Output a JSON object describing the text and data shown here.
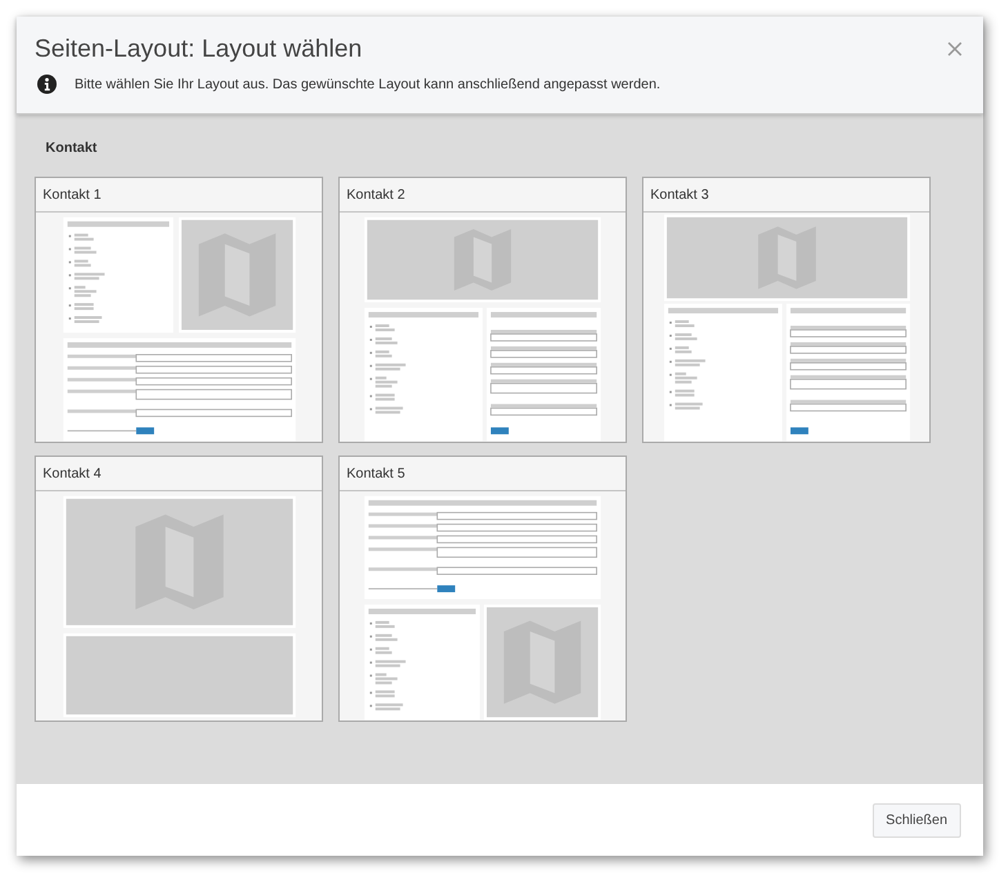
{
  "dialog": {
    "title": "Seiten-Layout: Layout wählen",
    "info": "Bitte wählen Sie Ihr Layout aus. Das gewünschte Layout kann anschließend angepasst werden.",
    "section": "Kontakt",
    "layouts": [
      {
        "title": "Kontakt 1",
        "kind": "split"
      },
      {
        "title": "Kontakt 2",
        "kind": "banner"
      },
      {
        "title": "Kontakt 3",
        "kind": "wide"
      },
      {
        "title": "Kontakt 4",
        "kind": "stacked"
      },
      {
        "title": "Kontakt 5",
        "kind": "formfirst"
      }
    ],
    "close_button": "Schließen"
  }
}
